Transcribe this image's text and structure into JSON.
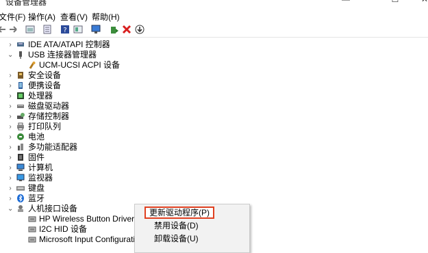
{
  "window": {
    "title": "设备管理器",
    "min": "—",
    "max": "☐",
    "close": "✕"
  },
  "menu": [
    "文件(F)",
    "操作(A)",
    "查看(V)",
    "帮助(H)"
  ],
  "toolbar_icons": [
    "back-arrow-icon",
    "forward-arrow-icon",
    "properties-icon",
    "device-list-icon",
    "help-icon",
    "details-icon",
    "monitor-icon",
    "update-driver-icon",
    "uninstall-icon",
    "download-icon"
  ],
  "tree": [
    {
      "label": "IDE ATA/ATAPI 控制器",
      "expanded": false,
      "icon": "ide-controller-icon",
      "level": 0
    },
    {
      "label": "USB 连接器管理器",
      "expanded": true,
      "icon": "usb-connector-icon",
      "level": 0
    },
    {
      "label": "UCM-UCSI ACPI 设备",
      "icon": "usb-device-icon",
      "level": 1
    },
    {
      "label": "安全设备",
      "expanded": false,
      "icon": "security-device-icon",
      "level": 0
    },
    {
      "label": "便携设备",
      "expanded": false,
      "icon": "portable-device-icon",
      "level": 0
    },
    {
      "label": "处理器",
      "expanded": false,
      "icon": "processor-icon",
      "level": 0
    },
    {
      "label": "磁盘驱动器",
      "expanded": false,
      "icon": "disk-drive-icon",
      "level": 0
    },
    {
      "label": "存储控制器",
      "expanded": false,
      "icon": "storage-controller-icon",
      "level": 0
    },
    {
      "label": "打印队列",
      "expanded": false,
      "icon": "printer-icon",
      "level": 0
    },
    {
      "label": "电池",
      "expanded": false,
      "icon": "battery-icon",
      "level": 0
    },
    {
      "label": "多功能适配器",
      "expanded": false,
      "icon": "multifunction-adapter-icon",
      "level": 0
    },
    {
      "label": "固件",
      "expanded": false,
      "icon": "firmware-icon",
      "level": 0
    },
    {
      "label": "计算机",
      "expanded": false,
      "icon": "computer-icon",
      "level": 0
    },
    {
      "label": "监视器",
      "expanded": false,
      "icon": "monitor-icon",
      "level": 0
    },
    {
      "label": "键盘",
      "expanded": false,
      "icon": "keyboard-icon",
      "level": 0
    },
    {
      "label": "蓝牙",
      "expanded": false,
      "icon": "bluetooth-icon",
      "level": 0
    },
    {
      "label": "人机接口设备",
      "expanded": true,
      "icon": "hid-icon",
      "level": 0
    },
    {
      "label": "HP Wireless Button Driver",
      "icon": "hid-device-icon",
      "level": 1
    },
    {
      "label": "I2C HID 设备",
      "icon": "hid-device-icon",
      "level": 1
    },
    {
      "label": "Microsoft Input Configuration D",
      "icon": "hid-device-icon",
      "level": 1
    }
  ],
  "context_menu": [
    "更新驱动程序(P)",
    "禁用设备(D)",
    "卸载设备(U)"
  ],
  "colors": {
    "highlight_border": "#e04020"
  }
}
